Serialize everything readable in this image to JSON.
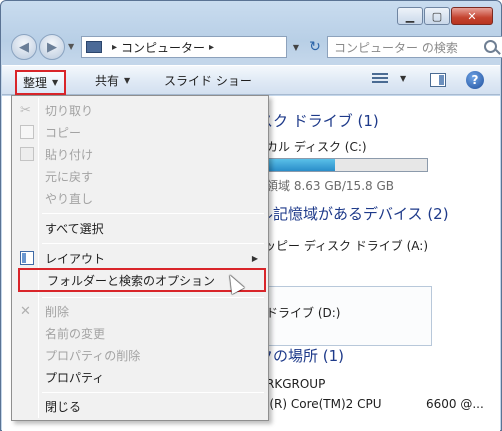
{
  "window": {
    "caption_glyphs": {
      "minimize": "▁",
      "maximize": "▢",
      "close": "✕"
    }
  },
  "nav": {
    "address_crumb": "コンピューター",
    "search_placeholder": "コンピューター の検索"
  },
  "cmdbar": {
    "organize": "整理",
    "share": "共有",
    "slideshow": "スライド ショー"
  },
  "content": {
    "section_hdd": "スク ドライブ (1)",
    "drive_c_name": "カル ディスク (C:)",
    "drive_c_free": "領域 8.63 GB/15.8 GB",
    "drive_c_used_fraction": 0.45,
    "section_removable": "ル記憶域があるデバイス (2)",
    "floppy_name": "ッピー ディスク ドライブ (A:)",
    "dvd_name": "ドライブ (D:)",
    "section_other": "クの場所 (1)",
    "workgroup": "RKGROUP",
    "cpu_line": "l(R) Core(TM)2 CPU",
    "cpu_speed": "6600  @..."
  },
  "menu": {
    "items": [
      {
        "label": "切り取り",
        "icon": "scissors-icon",
        "disabled": true
      },
      {
        "label": "コピー",
        "icon": "copy-icon",
        "disabled": true
      },
      {
        "label": "貼り付け",
        "icon": "paste-icon",
        "disabled": true
      },
      {
        "label": "元に戻す",
        "disabled": true
      },
      {
        "label": "やり直し",
        "disabled": true
      },
      {
        "label": "すべて選択",
        "disabled": false
      },
      {
        "label": "レイアウト",
        "icon": "layout-icon",
        "disabled": false,
        "submenu": true
      },
      {
        "label": "フォルダーと検索のオプション",
        "disabled": false,
        "highlight": true
      },
      {
        "label": "削除",
        "icon": "delete-icon",
        "disabled": true
      },
      {
        "label": "名前の変更",
        "disabled": true
      },
      {
        "label": "プロパティの削除",
        "disabled": true
      },
      {
        "label": "プロパティ",
        "disabled": false
      },
      {
        "label": "閉じる",
        "disabled": false
      }
    ]
  },
  "colors": {
    "highlight_border": "#d9252a",
    "section_header": "#1e3a8a",
    "disabled_text": "#a3a3a3"
  }
}
